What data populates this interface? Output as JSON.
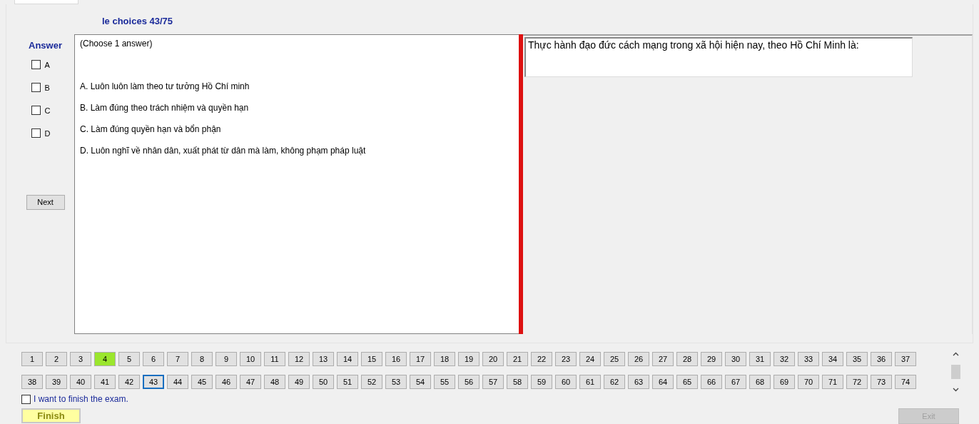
{
  "exam": {
    "title": "le choices 43/75"
  },
  "answer": {
    "heading": "Answer",
    "options": [
      {
        "label": "A",
        "checked": false
      },
      {
        "label": "B",
        "checked": false
      },
      {
        "label": "C",
        "checked": false
      },
      {
        "label": "D",
        "checked": false
      }
    ],
    "next_button": "Next"
  },
  "choices": {
    "instruction": "(Choose 1 answer)",
    "items": [
      "A.  Luôn luôn làm theo tư tưởng Hồ Chí minh",
      "B.  Làm đúng theo trách nhiệm và quyền hạn",
      "C.  Làm đúng quyền hạn và bổn phận",
      "D.  Luôn nghĩ về nhân dân, xuất phát từ dân mà làm, không phạm pháp luật"
    ]
  },
  "question": {
    "text": "Thực hành đạo đức cách mạng trong xã hội hiện nay, theo Hồ Chí Minh là:"
  },
  "question_buttons": [
    {
      "label": "1",
      "answered": false,
      "selected": false
    },
    {
      "label": "2",
      "answered": false,
      "selected": false
    },
    {
      "label": "3",
      "answered": false,
      "selected": false
    },
    {
      "label": "4",
      "answered": true,
      "selected": false
    },
    {
      "label": "5",
      "answered": false,
      "selected": false
    },
    {
      "label": "6",
      "answered": false,
      "selected": false
    },
    {
      "label": "7",
      "answered": false,
      "selected": false
    },
    {
      "label": "8",
      "answered": false,
      "selected": false
    },
    {
      "label": "9",
      "answered": false,
      "selected": false
    },
    {
      "label": "10",
      "answered": false,
      "selected": false
    },
    {
      "label": "11",
      "answered": false,
      "selected": false
    },
    {
      "label": "12",
      "answered": false,
      "selected": false
    },
    {
      "label": "13",
      "answered": false,
      "selected": false
    },
    {
      "label": "14",
      "answered": false,
      "selected": false
    },
    {
      "label": "15",
      "answered": false,
      "selected": false
    },
    {
      "label": "16",
      "answered": false,
      "selected": false
    },
    {
      "label": "17",
      "answered": false,
      "selected": false
    },
    {
      "label": "18",
      "answered": false,
      "selected": false
    },
    {
      "label": "19",
      "answered": false,
      "selected": false
    },
    {
      "label": "20",
      "answered": false,
      "selected": false
    },
    {
      "label": "21",
      "answered": false,
      "selected": false
    },
    {
      "label": "22",
      "answered": false,
      "selected": false
    },
    {
      "label": "23",
      "answered": false,
      "selected": false
    },
    {
      "label": "24",
      "answered": false,
      "selected": false
    },
    {
      "label": "25",
      "answered": false,
      "selected": false
    },
    {
      "label": "26",
      "answered": false,
      "selected": false
    },
    {
      "label": "27",
      "answered": false,
      "selected": false
    },
    {
      "label": "28",
      "answered": false,
      "selected": false
    },
    {
      "label": "29",
      "answered": false,
      "selected": false
    },
    {
      "label": "30",
      "answered": false,
      "selected": false
    },
    {
      "label": "31",
      "answered": false,
      "selected": false
    },
    {
      "label": "32",
      "answered": false,
      "selected": false
    },
    {
      "label": "33",
      "answered": false,
      "selected": false
    },
    {
      "label": "34",
      "answered": false,
      "selected": false
    },
    {
      "label": "35",
      "answered": false,
      "selected": false
    },
    {
      "label": "36",
      "answered": false,
      "selected": false
    },
    {
      "label": "37",
      "answered": false,
      "selected": false
    },
    {
      "label": "38",
      "answered": false,
      "selected": false
    },
    {
      "label": "39",
      "answered": false,
      "selected": false
    },
    {
      "label": "40",
      "answered": false,
      "selected": false
    },
    {
      "label": "41",
      "answered": false,
      "selected": false
    },
    {
      "label": "42",
      "answered": false,
      "selected": false
    },
    {
      "label": "43",
      "answered": false,
      "selected": true
    },
    {
      "label": "44",
      "answered": false,
      "selected": false
    },
    {
      "label": "45",
      "answered": false,
      "selected": false
    },
    {
      "label": "46",
      "answered": false,
      "selected": false
    },
    {
      "label": "47",
      "answered": false,
      "selected": false
    },
    {
      "label": "48",
      "answered": false,
      "selected": false
    },
    {
      "label": "49",
      "answered": false,
      "selected": false
    },
    {
      "label": "50",
      "answered": false,
      "selected": false
    },
    {
      "label": "51",
      "answered": false,
      "selected": false
    },
    {
      "label": "52",
      "answered": false,
      "selected": false
    },
    {
      "label": "53",
      "answered": false,
      "selected": false
    },
    {
      "label": "54",
      "answered": false,
      "selected": false
    },
    {
      "label": "55",
      "answered": false,
      "selected": false
    },
    {
      "label": "56",
      "answered": false,
      "selected": false
    },
    {
      "label": "57",
      "answered": false,
      "selected": false
    },
    {
      "label": "58",
      "answered": false,
      "selected": false
    },
    {
      "label": "59",
      "answered": false,
      "selected": false
    },
    {
      "label": "60",
      "answered": false,
      "selected": false
    },
    {
      "label": "61",
      "answered": false,
      "selected": false
    },
    {
      "label": "62",
      "answered": false,
      "selected": false
    },
    {
      "label": "63",
      "answered": false,
      "selected": false
    },
    {
      "label": "64",
      "answered": false,
      "selected": false
    },
    {
      "label": "65",
      "answered": false,
      "selected": false
    },
    {
      "label": "66",
      "answered": false,
      "selected": false
    },
    {
      "label": "67",
      "answered": false,
      "selected": false
    },
    {
      "label": "68",
      "answered": false,
      "selected": false
    },
    {
      "label": "69",
      "answered": false,
      "selected": false
    },
    {
      "label": "70",
      "answered": false,
      "selected": false
    },
    {
      "label": "71",
      "answered": false,
      "selected": false
    },
    {
      "label": "72",
      "answered": false,
      "selected": false
    },
    {
      "label": "73",
      "answered": false,
      "selected": false
    },
    {
      "label": "74",
      "answered": false,
      "selected": false
    }
  ],
  "finish_confirm": {
    "label": "I want to finish the exam.",
    "checked": false
  },
  "finish_button": "Finish",
  "exit_button": {
    "label": "Exit",
    "disabled": true
  }
}
